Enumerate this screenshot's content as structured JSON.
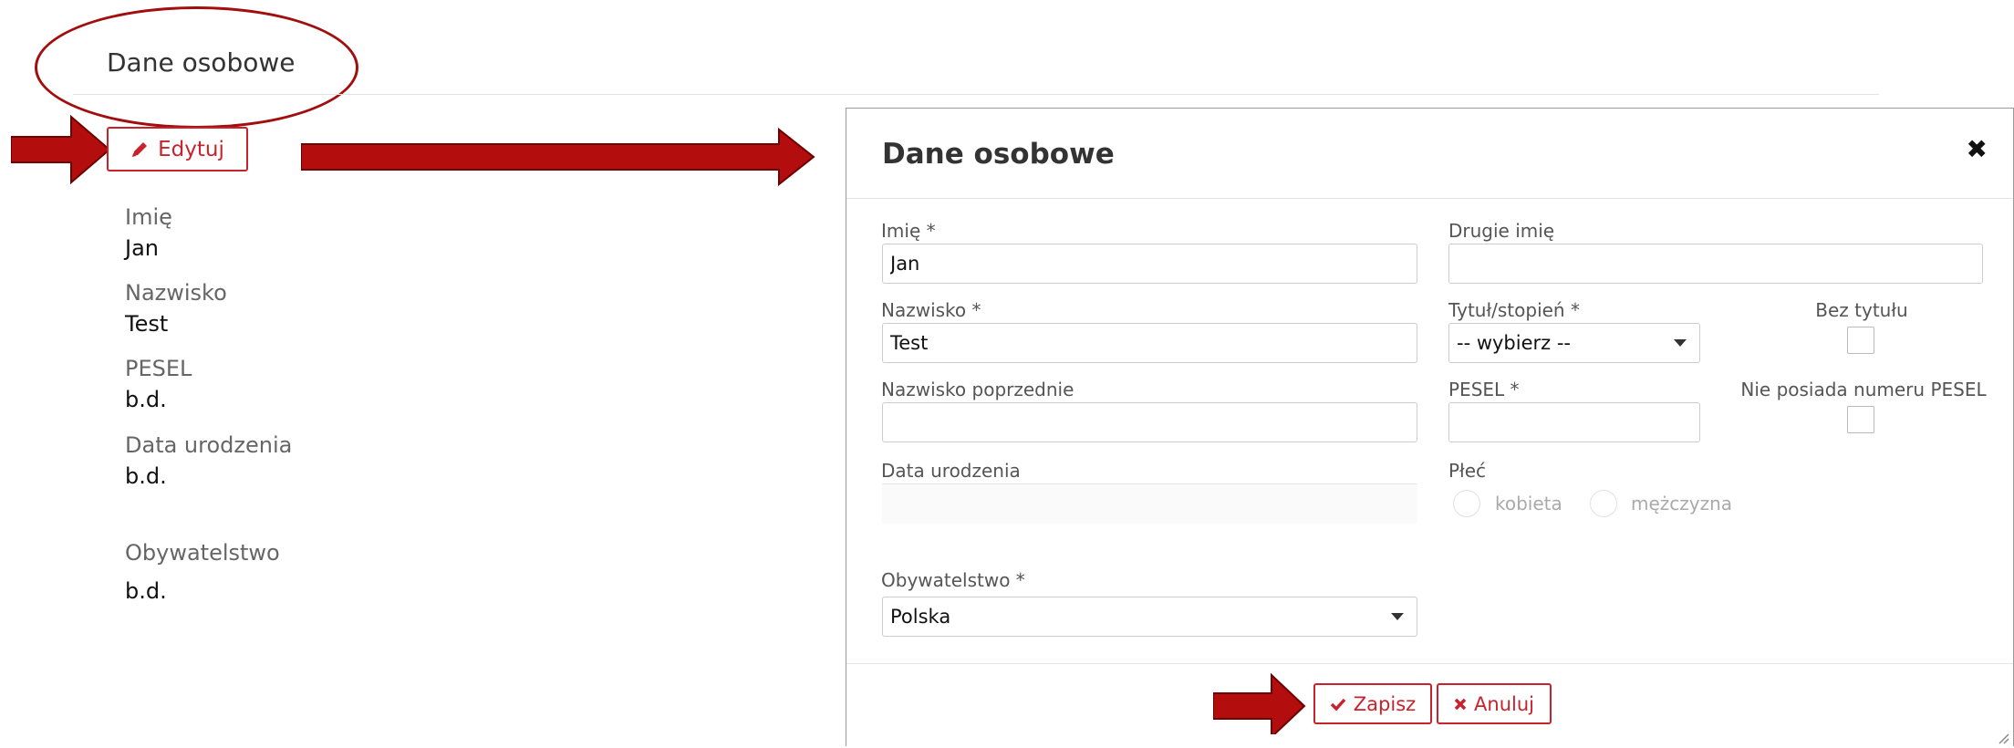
{
  "section": {
    "title": "Dane osobowe",
    "edit_label": "Edytuj",
    "fields": [
      {
        "label": "Imię",
        "value": "Jan"
      },
      {
        "label": "Nazwisko",
        "value": "Test"
      },
      {
        "label": "PESEL",
        "value": "b.d."
      },
      {
        "label": "Data urodzenia",
        "value": "b.d."
      },
      {
        "label": "Obywatelstwo",
        "value": "b.d."
      }
    ]
  },
  "modal": {
    "title": "Dane osobowe",
    "close_symbol": "✖",
    "first_name": {
      "label": "Imię *",
      "value": "Jan"
    },
    "second_name": {
      "label": "Drugie imię",
      "value": ""
    },
    "last_name": {
      "label": "Nazwisko *",
      "value": "Test"
    },
    "title_degree": {
      "label": "Tytuł/stopień *",
      "selected": "-- wybierz --"
    },
    "no_title": {
      "label": "Bez tytułu",
      "checked": false
    },
    "previous_last_name": {
      "label": "Nazwisko poprzednie",
      "value": ""
    },
    "pesel": {
      "label": "PESEL *",
      "value": ""
    },
    "no_pesel": {
      "label": "Nie posiada numeru PESEL",
      "checked": false
    },
    "birth_date": {
      "label": "Data urodzenia",
      "value": ""
    },
    "gender": {
      "label": "Płeć",
      "options": [
        "kobieta",
        "mężczyzna"
      ]
    },
    "citizenship": {
      "label": "Obywatelstwo *",
      "selected": "Polska"
    },
    "save_label": "Zapisz",
    "cancel_label": "Anuluj"
  },
  "colors": {
    "accent": "#c8232c",
    "annotation": "#a20d0d"
  },
  "icons": {
    "edit": "pencil-icon",
    "save": "check-icon",
    "cancel": "times-icon",
    "close": "close-icon"
  }
}
